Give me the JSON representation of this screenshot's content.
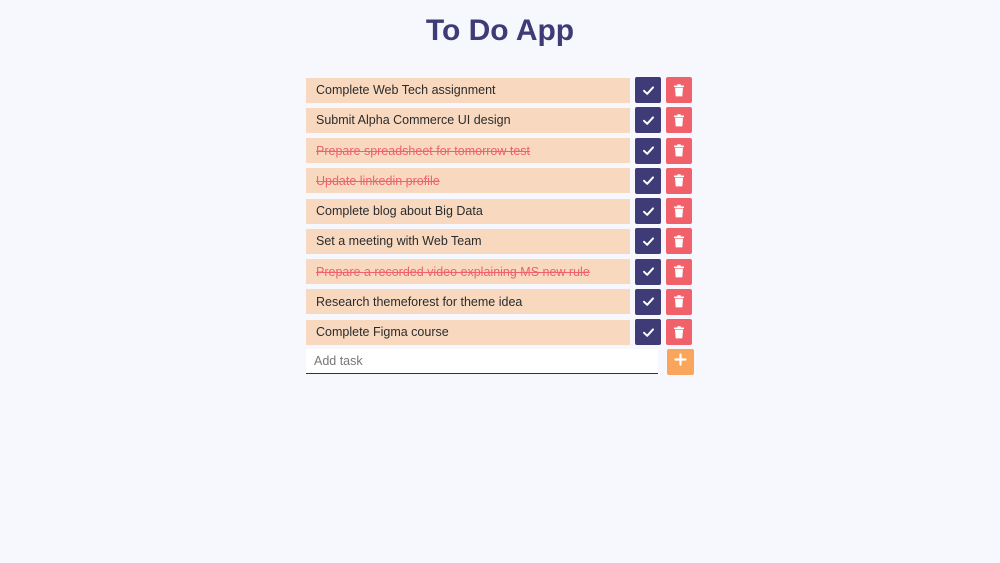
{
  "app": {
    "title": "To Do App"
  },
  "tasks": [
    {
      "label": "Complete Web Tech assignment",
      "done": false
    },
    {
      "label": "Submit Alpha Commerce UI design",
      "done": false
    },
    {
      "label": "Prepare spreadsheet for tomorrow test",
      "done": true
    },
    {
      "label": "Update linkedin profile",
      "done": true
    },
    {
      "label": "Complete blog about Big Data",
      "done": false
    },
    {
      "label": "Set a meeting with Web Team",
      "done": false
    },
    {
      "label": "Prepare a recorded video explaining MS new rule",
      "done": true
    },
    {
      "label": "Research themeforest for theme idea",
      "done": false
    },
    {
      "label": "Complete Figma course",
      "done": false
    }
  ],
  "add_task": {
    "placeholder": "Add task",
    "value": ""
  },
  "icons": {
    "complete": "check-icon",
    "delete": "trash-icon",
    "add": "plus-icon"
  },
  "colors": {
    "primary": "#3f3b77",
    "danger": "#f0616a",
    "accent": "#f9a55c",
    "task_bg": "#f8d9c0",
    "page_bg": "#f7f8fd"
  }
}
